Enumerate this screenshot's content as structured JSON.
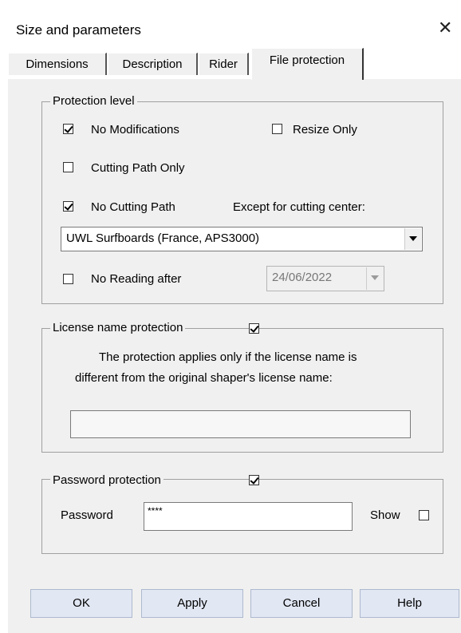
{
  "window": {
    "title": "Size and parameters",
    "close_glyph": "✕"
  },
  "tabs": [
    {
      "label": "Dimensions"
    },
    {
      "label": "Description"
    },
    {
      "label": "Rider"
    },
    {
      "label": "File protection",
      "active": true
    }
  ],
  "protection_level": {
    "legend": "Protection level",
    "no_modifications": {
      "label": "No Modifications",
      "checked": true
    },
    "resize_only": {
      "label": "Resize Only",
      "checked": false
    },
    "cutting_path_only": {
      "label": "Cutting Path Only",
      "checked": false
    },
    "no_cutting_path": {
      "label": "No Cutting Path",
      "checked": true
    },
    "except_label": "Except for cutting center:",
    "cutting_center_select": {
      "value": "UWL Surfboards (France, APS3000)"
    },
    "no_reading_after": {
      "label": "No Reading after",
      "checked": false
    },
    "reading_date_select": {
      "value": "24/06/2022"
    }
  },
  "license_protection": {
    "legend": "License name protection",
    "checked": true,
    "description_line1": "The protection applies only if the license name is",
    "description_line2": "different from the original shaper's license name:",
    "license_field_value": ""
  },
  "password_protection": {
    "legend": "Password protection",
    "checked": true,
    "password_label": "Password",
    "password_value": "****",
    "show_label": "Show",
    "show_checked": false
  },
  "buttons": {
    "ok": "OK",
    "apply": "Apply",
    "cancel": "Cancel",
    "help": "Help"
  },
  "colors": {
    "button_face": "#e1e7f3",
    "dialog_bg": "#f0f0f0"
  }
}
